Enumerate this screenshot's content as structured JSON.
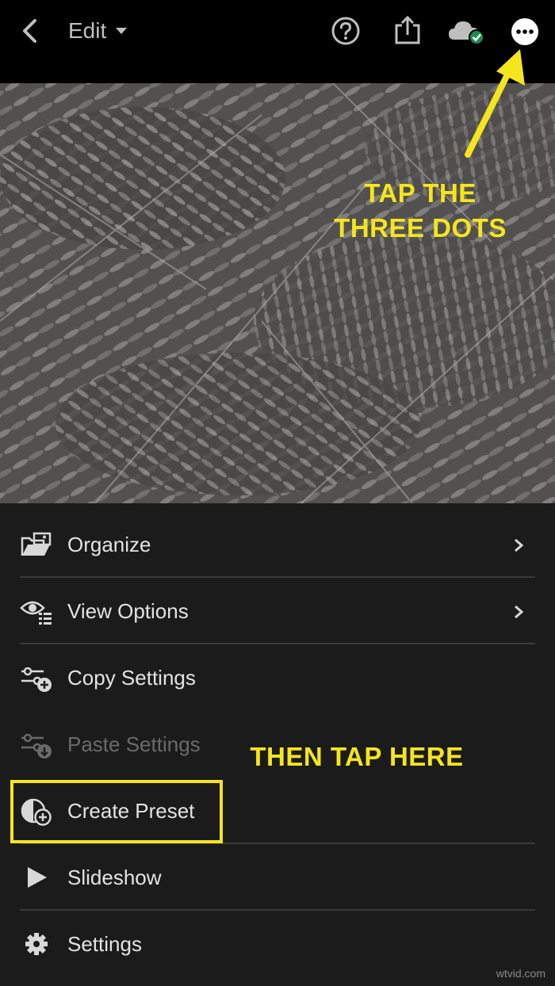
{
  "topbar": {
    "mode_label": "Edit",
    "icons": [
      "back-chevron-icon",
      "caret-down-icon",
      "help-icon",
      "share-icon",
      "cloud-synced-icon",
      "more-dots-icon"
    ]
  },
  "annotations": {
    "top_line1": "TAP THE",
    "top_line2": "THREE DOTS",
    "bottom": "THEN TAP HERE",
    "color": "#f5e51c"
  },
  "menu": {
    "items": [
      {
        "label": "Organize",
        "icon": "organize-icon",
        "has_chevron": true,
        "enabled": true
      },
      {
        "label": "View Options",
        "icon": "view-options-icon",
        "has_chevron": true,
        "enabled": true
      },
      {
        "label": "Copy Settings",
        "icon": "copy-settings-icon",
        "has_chevron": false,
        "enabled": true
      },
      {
        "label": "Paste Settings",
        "icon": "paste-settings-icon",
        "has_chevron": false,
        "enabled": false
      },
      {
        "label": "Create Preset",
        "icon": "create-preset-icon",
        "has_chevron": false,
        "enabled": true,
        "highlighted": true
      },
      {
        "label": "Slideshow",
        "icon": "play-icon",
        "has_chevron": false,
        "enabled": true
      },
      {
        "label": "Settings",
        "icon": "gear-icon",
        "has_chevron": false,
        "enabled": true
      }
    ]
  },
  "watermark": "wtvid.com"
}
